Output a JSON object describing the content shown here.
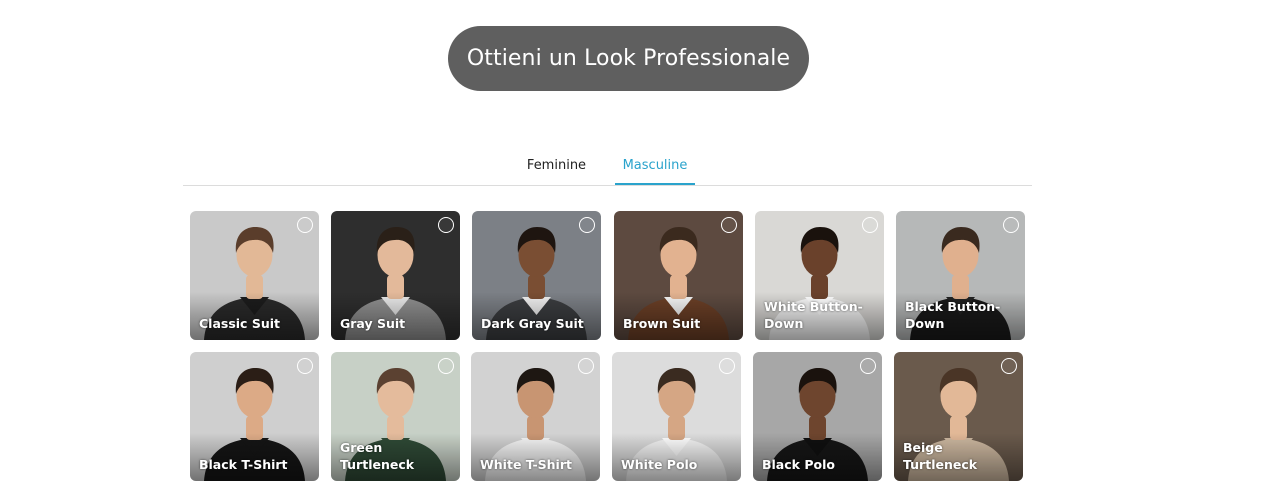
{
  "cta": {
    "label": "Ottieni un Look Professionale"
  },
  "tabs": [
    {
      "label": "Feminine",
      "active": false
    },
    {
      "label": "Masculine",
      "active": true
    }
  ],
  "colors": {
    "accent": "#2aa3cc",
    "button_bg": "#5f5f5f"
  },
  "styles": [
    {
      "label": "Classic Suit",
      "bg": "#c9c9c9",
      "skin": "#e2b896",
      "hair": "#5a3d2b",
      "cloth": "#2a2a2a",
      "collar": "#1c1c1c"
    },
    {
      "label": "Gray Suit",
      "bg": "#2e2e2e",
      "skin": "#e3b99a",
      "hair": "#2a2018",
      "cloth": "#8f8f8f",
      "collar": "#e8e8e8"
    },
    {
      "label": "Dark Gray Suit",
      "bg": "#7c8086",
      "skin": "#7a4e33",
      "hair": "#1e1510",
      "cloth": "#3b3d40",
      "collar": "#f0f0f0"
    },
    {
      "label": "Brown Suit",
      "bg": "#5d4a40",
      "skin": "#e2b290",
      "hair": "#3b2a1e",
      "cloth": "#6b3f26",
      "collar": "#f5f5f5"
    },
    {
      "label": "White Button-Down",
      "bg": "#d9d8d5",
      "skin": "#6a412b",
      "hair": "#1a120d",
      "cloth": "#f7f7f7",
      "collar": "#ffffff"
    },
    {
      "label": "Black Button-Down",
      "bg": "#b6b8b8",
      "skin": "#e0b08e",
      "hair": "#3a2a1f",
      "cloth": "#1a1a1a",
      "collar": "#222222"
    },
    {
      "label": "Black T-Shirt",
      "bg": "#cfcfcf",
      "skin": "#dcaa86",
      "hair": "#2b1e16",
      "cloth": "#151515",
      "collar": "#151515"
    },
    {
      "label": "Green Turtleneck",
      "bg": "#c7d0c6",
      "skin": "#e4bb9c",
      "hair": "#5b4131",
      "cloth": "#2f4a36",
      "collar": "#2f4a36"
    },
    {
      "label": "White T-Shirt",
      "bg": "#d2d2d2",
      "skin": "#c89572",
      "hair": "#1e1712",
      "cloth": "#f5f5f5",
      "collar": "#f5f5f5"
    },
    {
      "label": "White Polo",
      "bg": "#dcdcdc",
      "skin": "#d5a684",
      "hair": "#3a2b20",
      "cloth": "#f4f4f4",
      "collar": "#ffffff"
    },
    {
      "label": "Black Polo",
      "bg": "#a7a7a7",
      "skin": "#6e452e",
      "hair": "#1a120d",
      "cloth": "#161616",
      "collar": "#101010"
    },
    {
      "label": "Beige Turtleneck",
      "bg": "#6a5a4c",
      "skin": "#e2b897",
      "hair": "#4a3526",
      "cloth": "#cdb8a0",
      "collar": "#cdb8a0"
    }
  ]
}
